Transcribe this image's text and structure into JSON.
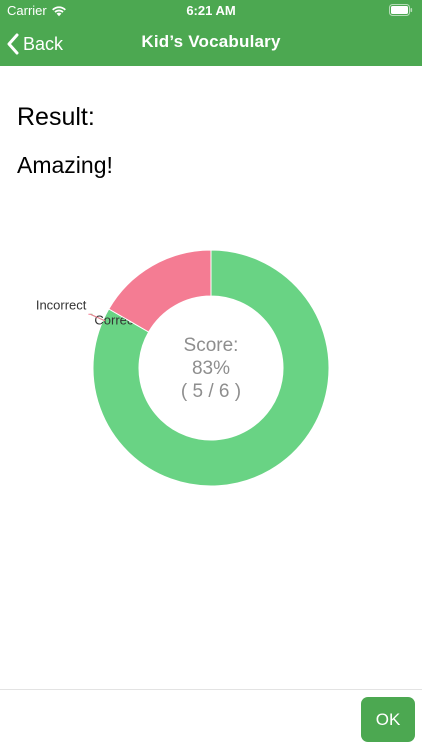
{
  "status_bar": {
    "carrier": "Carrier",
    "time": "6:21 AM",
    "wifi_icon": "wifi-icon",
    "battery_icon": "battery-icon"
  },
  "nav": {
    "back_label": "Back",
    "back_icon": "chevron-left-icon",
    "title": "Kid’s Vocabulary"
  },
  "result": {
    "label": "Result:",
    "verdict": "Amazing!"
  },
  "chart_data": {
    "type": "pie",
    "style": "donut",
    "categories": [
      "Correct",
      "Incorrect"
    ],
    "values": [
      5,
      1
    ],
    "colors": [
      "#69d384",
      "#f47c93"
    ],
    "center_text": [
      "Score:",
      "83%",
      "( 5 / 6 )"
    ]
  },
  "footer": {
    "ok_label": "OK"
  },
  "colors": {
    "accent": "#4ca851",
    "correct": "#69d384",
    "incorrect": "#f47c93"
  }
}
